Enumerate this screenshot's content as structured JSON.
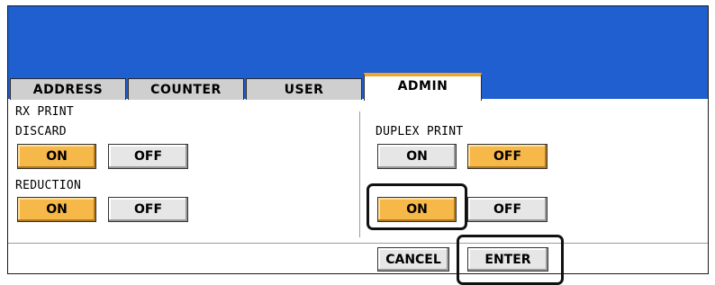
{
  "tabs": [
    {
      "label": "ADDRESS",
      "active": false
    },
    {
      "label": "COUNTER",
      "active": false
    },
    {
      "label": "USER",
      "active": false
    },
    {
      "label": "ADMIN",
      "active": true
    }
  ],
  "section_title": "RX PRINT",
  "discard": {
    "label": "DISCARD",
    "on": "ON",
    "off": "OFF",
    "selected": "ON"
  },
  "reduction": {
    "label": "REDUCTION",
    "on": "ON",
    "off": "OFF",
    "selected": "ON"
  },
  "duplex_print": {
    "label": "DUPLEX PRINT",
    "on": "ON",
    "off": "OFF",
    "selected": "OFF"
  },
  "paper_size": {
    "on": "ON",
    "off": "OFF",
    "selected": "ON"
  },
  "actions": {
    "cancel": "CANCEL",
    "enter": "ENTER"
  },
  "colors": {
    "header": "#1f5fd0",
    "selected": "#f7b84a",
    "tab_accent": "#f2a52a"
  }
}
